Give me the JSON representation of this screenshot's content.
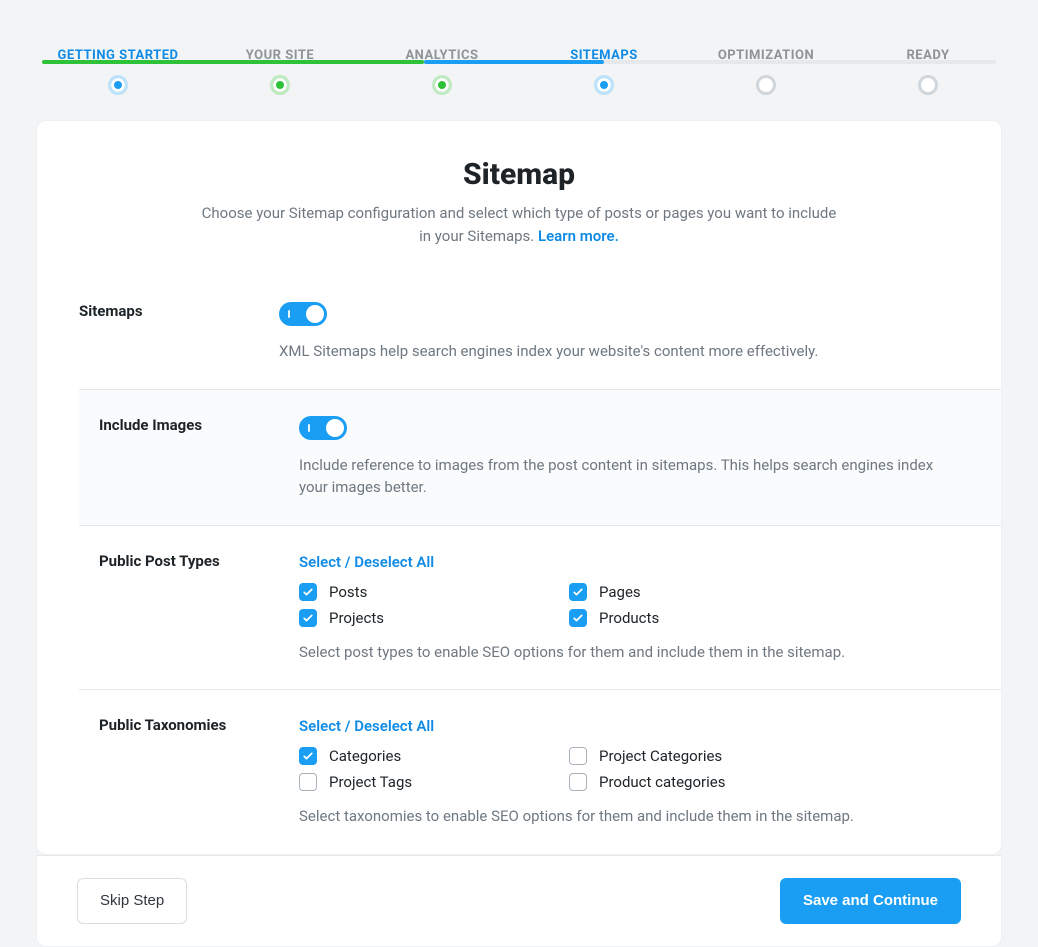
{
  "steps": [
    {
      "label": "GETTING STARTED",
      "state": "active"
    },
    {
      "label": "YOUR SITE",
      "state": "done"
    },
    {
      "label": "ANALYTICS",
      "state": "done"
    },
    {
      "label": "SITEMAPS",
      "state": "active"
    },
    {
      "label": "OPTIMIZATION",
      "state": "upcoming"
    },
    {
      "label": "READY",
      "state": "upcoming"
    }
  ],
  "page": {
    "title": "Sitemap",
    "subtitle": "Choose your Sitemap configuration and select which type of posts or pages you want to include in your Sitemaps. ",
    "learn_more": "Learn more."
  },
  "rows": {
    "sitemaps": {
      "label": "Sitemaps",
      "enabled": true,
      "help": "XML Sitemaps help search engines index your website's content more effectively."
    },
    "images": {
      "label": "Include Images",
      "enabled": true,
      "help": "Include reference to images from the post content in sitemaps. This helps search engines index your images better."
    },
    "post_types": {
      "label": "Public Post Types",
      "select_all": "Select / Deselect All",
      "items": [
        {
          "label": "Posts",
          "checked": true
        },
        {
          "label": "Pages",
          "checked": true
        },
        {
          "label": "Projects",
          "checked": true
        },
        {
          "label": "Products",
          "checked": true
        }
      ],
      "help": "Select post types to enable SEO options for them and include them in the sitemap."
    },
    "taxonomies": {
      "label": "Public Taxonomies",
      "select_all": "Select / Deselect All",
      "items": [
        {
          "label": "Categories",
          "checked": true
        },
        {
          "label": "Project Categories",
          "checked": false
        },
        {
          "label": "Project Tags",
          "checked": false
        },
        {
          "label": "Product categories",
          "checked": false
        }
      ],
      "help": "Select taxonomies to enable SEO options for them and include them in the sitemap."
    }
  },
  "footer": {
    "skip": "Skip Step",
    "continue": "Save and Continue"
  }
}
